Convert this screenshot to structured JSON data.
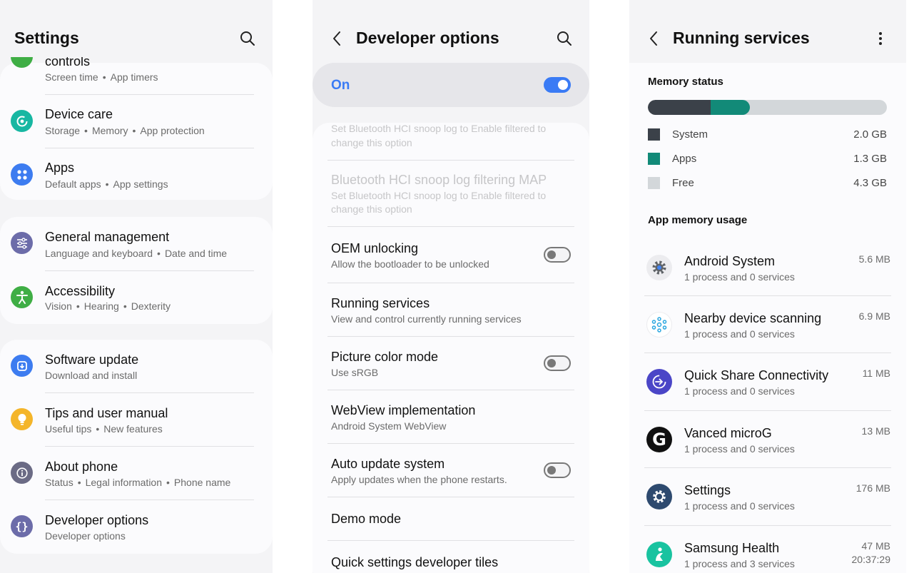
{
  "settings": {
    "title": "Settings",
    "partial_item": {
      "title": "controls",
      "sub": [
        "Screen time",
        "App timers"
      ]
    },
    "items": [
      {
        "title": "Device care",
        "sub": [
          "Storage",
          "Memory",
          "App protection"
        ],
        "icon": "device-care-icon",
        "color": "#17b7a2"
      },
      {
        "title": "Apps",
        "sub": [
          "Default apps",
          "App settings"
        ],
        "icon": "apps-icon",
        "color": "#3d7cf0"
      },
      {
        "title": "General management",
        "sub": [
          "Language and keyboard",
          "Date and time"
        ],
        "icon": "sliders-icon",
        "color": "#6c6ca9"
      },
      {
        "title": "Accessibility",
        "sub": [
          "Vision",
          "Hearing",
          "Dexterity"
        ],
        "icon": "accessibility-icon",
        "color": "#3fae45"
      },
      {
        "title": "Software update",
        "sub": [
          "Download and install"
        ],
        "icon": "software-update-icon",
        "color": "#3d7cf0"
      },
      {
        "title": "Tips and user manual",
        "sub": [
          "Useful tips",
          "New features"
        ],
        "icon": "lightbulb-icon",
        "color": "#f4b52a"
      },
      {
        "title": "About phone",
        "sub": [
          "Status",
          "Legal information",
          "Phone name"
        ],
        "icon": "info-icon",
        "color": "#6b6b85"
      },
      {
        "title": "Developer options",
        "sub": [
          "Developer options"
        ],
        "icon": "braces-icon",
        "color": "#6c6ca9"
      }
    ]
  },
  "developer": {
    "title": "Developer options",
    "master": {
      "label": "On",
      "state": "on"
    },
    "disabled_top": {
      "sub": [
        "Set Bluetooth HCI snoop log to Enable filtered to",
        "change this option"
      ]
    },
    "disabled_item": {
      "title": "Bluetooth HCI snoop log filtering MAP",
      "sub": [
        "Set Bluetooth HCI snoop log to Enable filtered to",
        "change this option"
      ]
    },
    "items": [
      {
        "title": "OEM unlocking",
        "sub": "Allow the bootloader to be unlocked",
        "toggle": "off"
      },
      {
        "title": "Running services",
        "sub": "View and control currently running services"
      },
      {
        "title": "Picture color mode",
        "sub": "Use sRGB",
        "toggle": "off"
      },
      {
        "title": "WebView implementation",
        "sub": "Android System WebView"
      },
      {
        "title": "Auto update system",
        "sub": "Apply updates when the phone restarts.",
        "toggle": "off"
      },
      {
        "title": "Demo mode"
      },
      {
        "title": "Quick settings developer tiles"
      }
    ]
  },
  "running": {
    "title": "Running services",
    "memory_status_label": "Memory status",
    "memory": {
      "system_fraction": 0.2623,
      "apps_fraction": 0.1639,
      "legend": [
        {
          "label": "System",
          "value": "2.0 GB",
          "color": "#3b4149"
        },
        {
          "label": "Apps",
          "value": "1.3 GB",
          "color": "#128a78"
        },
        {
          "label": "Free",
          "value": "4.3 GB",
          "color": "#d3d7da"
        }
      ]
    },
    "app_memory_label": "App memory usage",
    "apps": [
      {
        "name": "Android System",
        "sub": "1 process and 0 services",
        "size": "5.6 MB",
        "icon": "gear-icon"
      },
      {
        "name": "Nearby device scanning",
        "sub": "1 process and 0 services",
        "size": "6.9 MB",
        "icon": "nearby-icon"
      },
      {
        "name": "Quick Share Connectivity",
        "sub": "1 process and 0 services",
        "size": "11 MB",
        "icon": "quick-share-icon"
      },
      {
        "name": "Vanced microG",
        "sub": "1 process and 0 services",
        "size": "13 MB",
        "icon": "microg-icon"
      },
      {
        "name": "Settings",
        "sub": "1 process and 0 services",
        "size": "176 MB",
        "icon": "settings-gear-icon"
      },
      {
        "name": "Samsung Health",
        "sub": "1 process and 3 services",
        "size": "47 MB",
        "time": "20:37:29",
        "icon": "samsung-health-icon"
      }
    ]
  }
}
